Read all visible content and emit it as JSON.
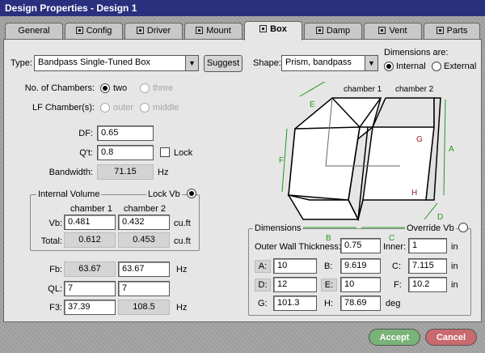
{
  "window": {
    "title": "Design Properties - Design 1"
  },
  "tabs": [
    {
      "label": "General",
      "icon": ""
    },
    {
      "label": "Config",
      "icon": "speaker-icon"
    },
    {
      "label": "Driver",
      "icon": "speaker-icon"
    },
    {
      "label": "Mount",
      "icon": "speaker-icon"
    },
    {
      "label": "Box",
      "icon": "box-icon"
    },
    {
      "label": "Damp",
      "icon": "box-icon"
    },
    {
      "label": "Vent",
      "icon": "box-icon"
    },
    {
      "label": "Parts",
      "icon": "box-icon"
    }
  ],
  "type": {
    "label": "Type:",
    "value": "Bandpass Single-Tuned Box",
    "suggest": "Suggest"
  },
  "shape": {
    "label": "Shape:",
    "value": "Prism, bandpass"
  },
  "dims_are": {
    "label": "Dimensions are:",
    "internal": "Internal",
    "external": "External"
  },
  "chambers": {
    "label": "No. of Chambers:",
    "two": "two",
    "three": "three"
  },
  "lf": {
    "label": "LF Chamber(s):",
    "outer": "outer",
    "middle": "middle"
  },
  "df": {
    "label": "DF:",
    "value": "0.65"
  },
  "qt": {
    "label": "Q't:",
    "value": "0.8",
    "lock": "Lock"
  },
  "bandwidth": {
    "label": "Bandwidth:",
    "value": "71.15",
    "unit": "Hz"
  },
  "iv": {
    "title": "Internal Volume",
    "lock": "Lock Vb",
    "ch1": "chamber 1",
    "ch2": "chamber 2",
    "vb_label": "Vb:",
    "vb1": "0.481",
    "vb2": "0.432",
    "unit": "cu.ft",
    "total_label": "Total:",
    "total1": "0.612",
    "total2": "0.453",
    "total_unit": "cu.ft"
  },
  "fb": {
    "label": "Fb:",
    "v1": "63.67",
    "v2": "63.67",
    "unit": "Hz"
  },
  "ql": {
    "label": "QL:",
    "v1": "7",
    "v2": "7"
  },
  "f3": {
    "label": "F3:",
    "v1": "37.39",
    "v2": "108.5",
    "unit": "Hz"
  },
  "diagram": {
    "ch1": "chamber 1",
    "ch2": "chamber 2",
    "A": "A",
    "B": "B",
    "C": "C",
    "D": "D",
    "E": "E",
    "F": "F",
    "G": "G",
    "H": "H",
    "dim_color": "#1f9a1f",
    "corner_color": "#9a1a2a"
  },
  "dims": {
    "title": "Dimensions",
    "override": "Override Vb",
    "wall_label": "Outer Wall Thickness:",
    "wall": "0.75",
    "inner_label": "Inner:",
    "inner": "1",
    "in": "in",
    "A_label": "A:",
    "A": "10",
    "B_label": "B:",
    "B": "9.619",
    "C_label": "C:",
    "C": "7.115",
    "D_label": "D:",
    "D": "12",
    "E_label": "E:",
    "E": "10",
    "F_label": "F:",
    "F": "10.2",
    "G_label": "G:",
    "G": "101.3",
    "H_label": "H:",
    "H": "78.69",
    "deg": "deg"
  },
  "footer": {
    "accept": "Accept",
    "cancel": "Cancel",
    "accept_color": "#79b377",
    "cancel_color": "#c96a6f"
  }
}
